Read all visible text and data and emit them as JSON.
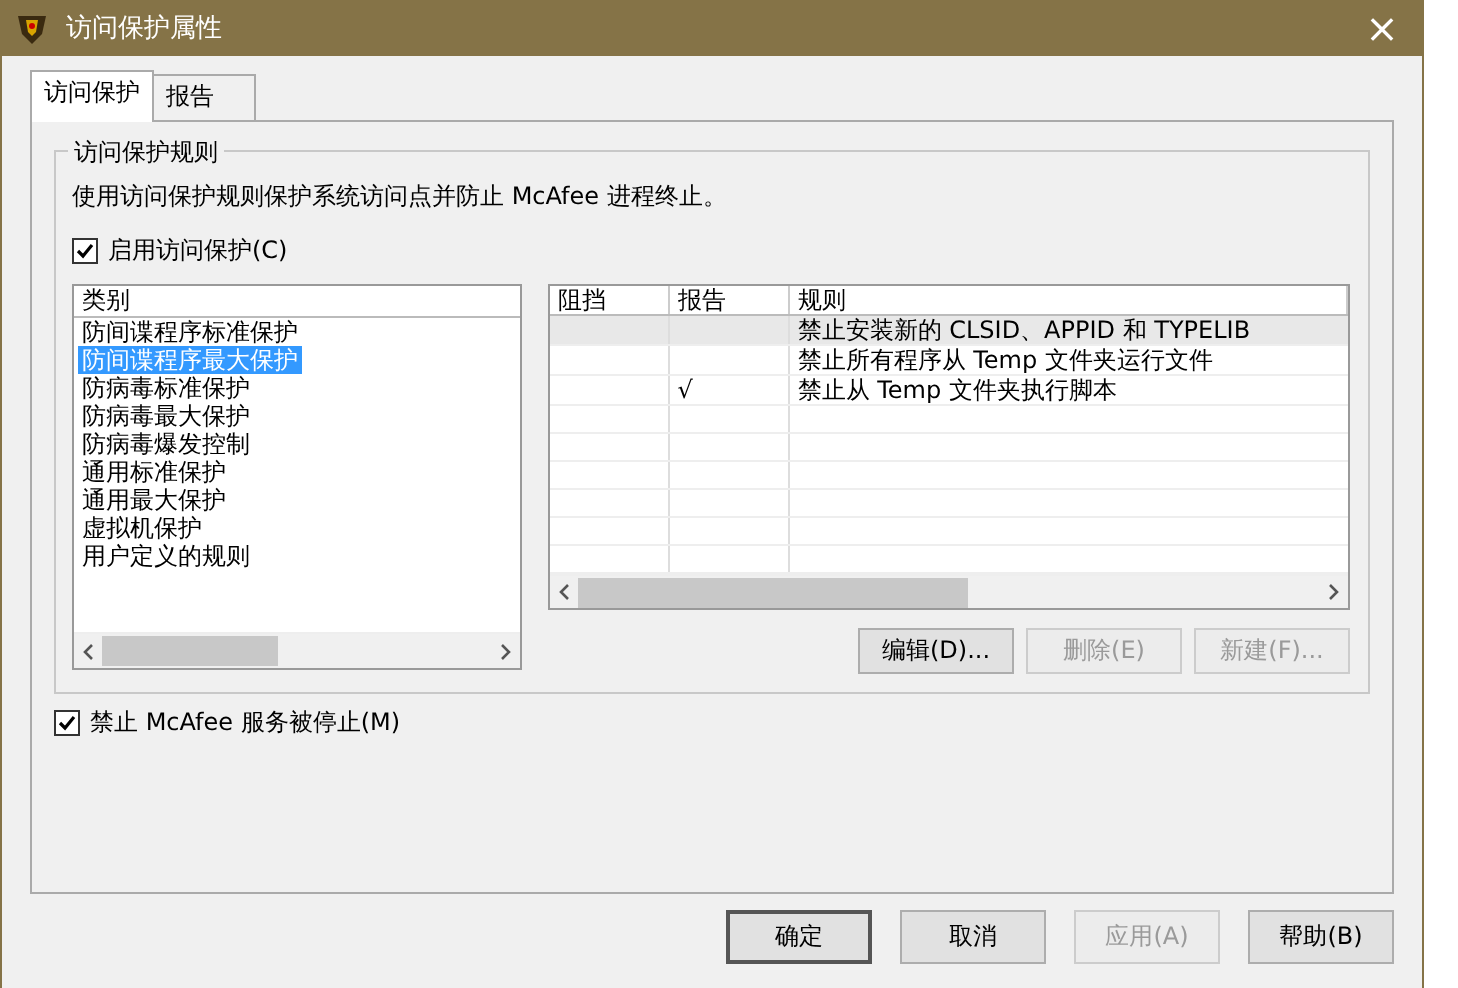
{
  "window": {
    "title": "访问保护属性",
    "close": "×"
  },
  "tabs": [
    {
      "label": "访问保护",
      "selected": true
    },
    {
      "label": "报告",
      "selected": false
    }
  ],
  "group": {
    "title": "访问保护规则",
    "description": "使用访问保护规则保护系统访问点并防止 McAfee 进程终止。",
    "enable": {
      "label": "启用访问保护(C)",
      "checked": true
    },
    "categories": {
      "header": "类别",
      "items": [
        {
          "label": "防间谍程序标准保护",
          "selected": false
        },
        {
          "label": "防间谍程序最大保护",
          "selected": true
        },
        {
          "label": "防病毒标准保护",
          "selected": false
        },
        {
          "label": "防病毒最大保护",
          "selected": false
        },
        {
          "label": "防病毒爆发控制",
          "selected": false
        },
        {
          "label": "通用标准保护",
          "selected": false
        },
        {
          "label": "通用最大保护",
          "selected": false
        },
        {
          "label": "虚拟机保护",
          "selected": false
        },
        {
          "label": "用户定义的规则",
          "selected": false
        }
      ]
    },
    "rules": {
      "columns": [
        "阻挡",
        "报告",
        "规则"
      ],
      "rows": [
        {
          "block": "",
          "report": "",
          "rule": "禁止安装新的 CLSID、APPID 和 TYPELIB",
          "selected": true
        },
        {
          "block": "",
          "report": "",
          "rule": "禁止所有程序从 Temp 文件夹运行文件",
          "selected": false
        },
        {
          "block": "",
          "report": "√",
          "rule": "禁止从 Temp 文件夹执行脚本",
          "selected": false
        }
      ]
    },
    "buttons": [
      {
        "label": "编辑(D)...",
        "disabled": false
      },
      {
        "label": "删除(E)",
        "disabled": true
      },
      {
        "label": "新建(F)...",
        "disabled": true
      }
    ]
  },
  "stop_service": {
    "label": "禁止 McAfee 服务被停止(M)",
    "checked": true
  },
  "footer_buttons": [
    {
      "label": "确定",
      "disabled": false,
      "default": true
    },
    {
      "label": "取消",
      "disabled": false,
      "default": false
    },
    {
      "label": "应用(A)",
      "disabled": true,
      "default": false
    },
    {
      "label": "帮助(B)",
      "disabled": false,
      "default": false
    }
  ]
}
